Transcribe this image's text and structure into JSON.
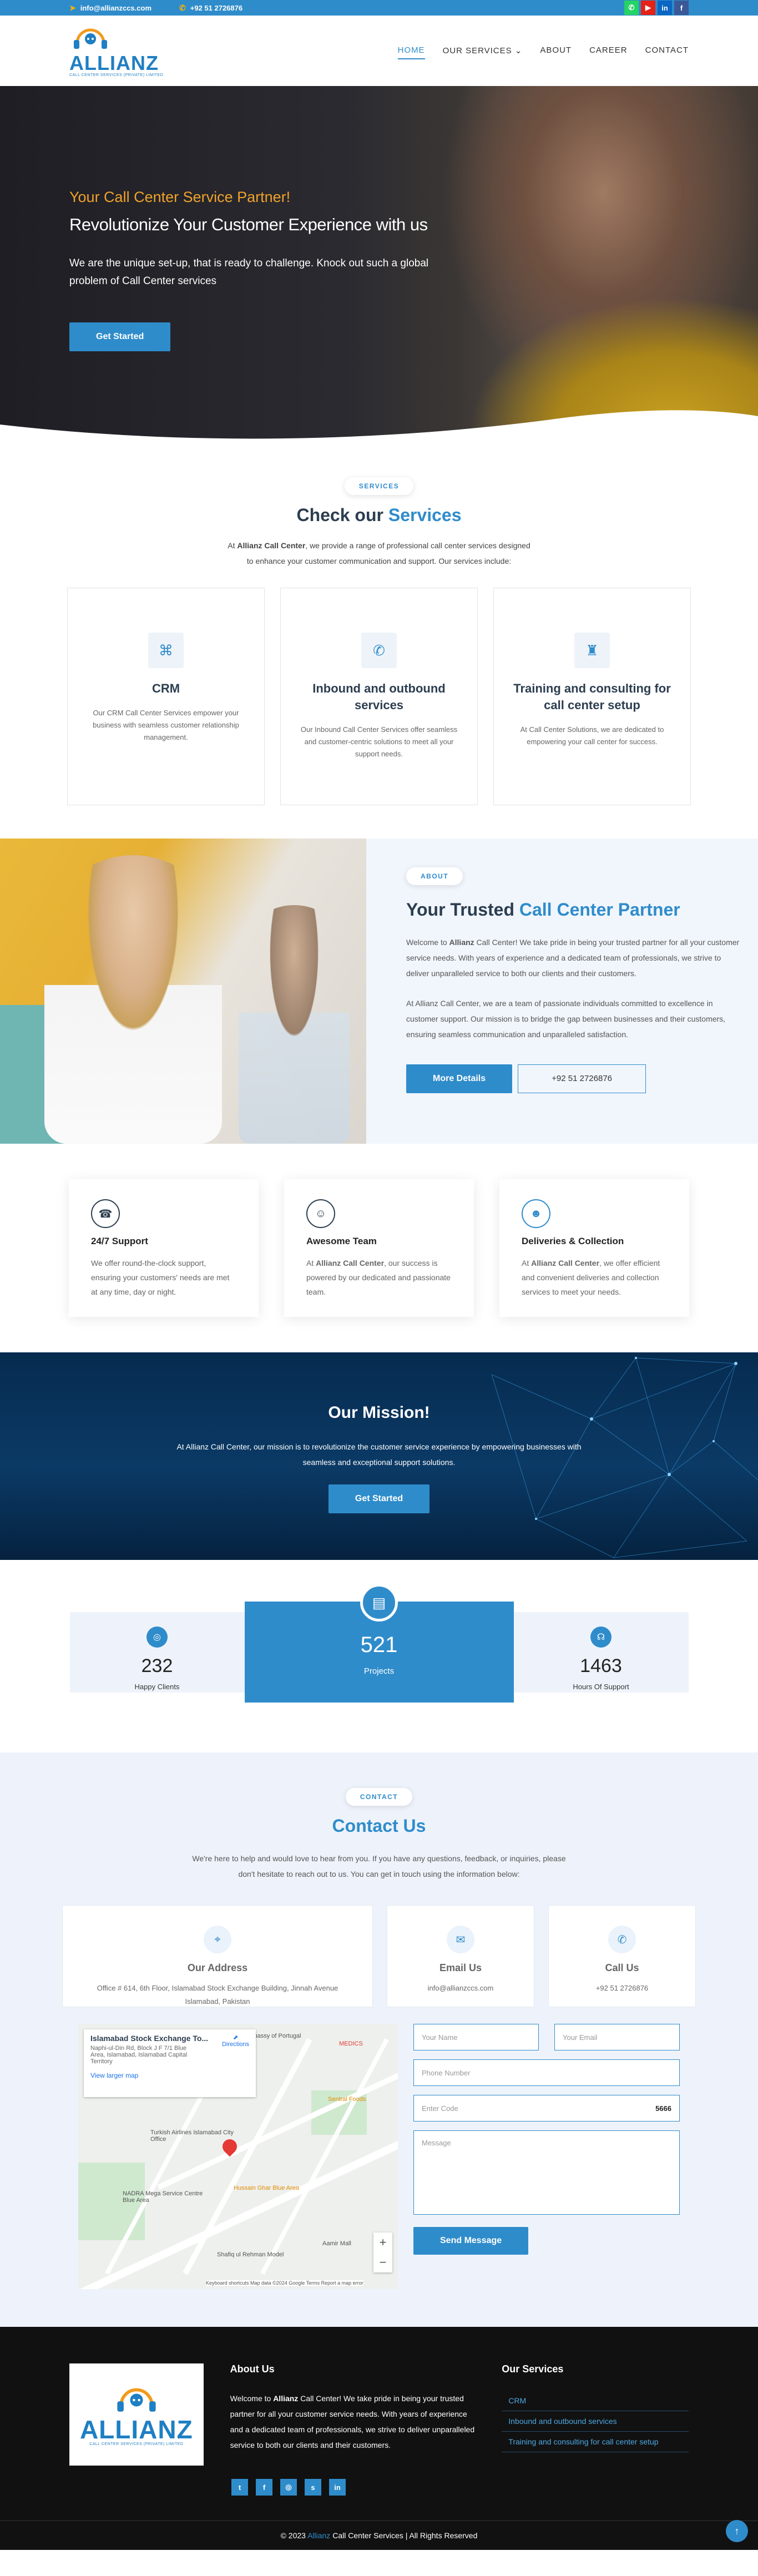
{
  "topbar": {
    "email": "info@allianzccs.com",
    "phone": "+92 51 2726876",
    "socials": [
      {
        "name": "whatsapp-icon",
        "glyph": "✆",
        "color": "#25d366"
      },
      {
        "name": "youtube-icon",
        "glyph": "▶",
        "color": "#e62117"
      },
      {
        "name": "linkedin-icon",
        "glyph": "in",
        "color": "#0a66c2"
      },
      {
        "name": "facebook-icon",
        "glyph": "f",
        "color": "#3b5998"
      }
    ]
  },
  "header": {
    "logo_text": "ALLIANZ",
    "logo_sub": "CALL CENTER SERVICES (PRIVATE) LIMITED",
    "nav": [
      "HOME",
      "OUR SERVICES",
      "ABOUT",
      "CAREER",
      "CONTACT"
    ]
  },
  "hero": {
    "tag": "Your Call Center Service Partner!",
    "title": "Revolutionize Your Customer Experience with us",
    "text": "We are the unique set-up, that is ready to challenge. Knock out such a global problem of Call Center services",
    "cta": "Get Started"
  },
  "services": {
    "pill": "SERVICES",
    "title_a": "Check our ",
    "title_b": "Services",
    "intro_a": "At ",
    "intro_brand": "Allianz Call Center",
    "intro_b": ", we provide a range of professional call center services designed to enhance your customer communication and support. Our services include:",
    "cards": [
      {
        "title": "CRM",
        "text": "Our CRM Call Center Services empower your business with seamless customer relationship management."
      },
      {
        "title": "Inbound and outbound services",
        "text": "Our Inbound Call Center Services offer seamless and customer-centric solutions to meet all your support needs."
      },
      {
        "title": "Training and consulting for call center setup",
        "text": "At Call Center Solutions, we are dedicated to empowering your call center for success."
      }
    ]
  },
  "about": {
    "pill": "ABOUT",
    "title_a": "Your Trusted ",
    "title_b": "Call Center Partner",
    "p1_a": "Welcome to ",
    "p1_brand": "Allianz",
    "p1_b": " Call Center! We take pride in being your trusted partner for all your customer service needs. With years of experience and a dedicated team of professionals, we strive to deliver unparalleled service to both our clients and their customers.",
    "p2": "At Allianz Call Center, we are a team of passionate individuals committed to excellence in customer support. Our mission is to bridge the gap between businesses and their customers, ensuring seamless communication and unparalleled satisfaction.",
    "btn_more": "More Details",
    "btn_phone": "+92 51 2726876"
  },
  "features": [
    {
      "title": "24/7 Support",
      "text_a": "",
      "brand": "",
      "text_b": "We offer round-the-clock support, ensuring your customers' needs are met at any time, day or night."
    },
    {
      "title": "Awesome Team",
      "text_a": "At ",
      "brand": "Allianz Call Center",
      "text_b": ", our success is powered by our dedicated and passionate team."
    },
    {
      "title": "Deliveries & Collection",
      "text_a": "At ",
      "brand": "Allianz Call Center",
      "text_b": ", we offer efficient and convenient deliveries and collection services to meet your needs."
    }
  ],
  "mission": {
    "title": "Our Mission!",
    "text": "At Allianz Call Center, our mission is to revolutionize the customer service experience by empowering businesses with seamless and exceptional support solutions.",
    "cta": "Get Started"
  },
  "stats": [
    {
      "value": "232",
      "label": "Happy Clients"
    },
    {
      "value": "521",
      "label": "Projects"
    },
    {
      "value": "1463",
      "label": "Hours Of Support"
    }
  ],
  "contact": {
    "pill": "CONTACT",
    "title": "Contact Us",
    "intro": "We're here to help and would love to hear from you. If you have any questions, feedback, or inquiries, please don't hesitate to reach out to us. You can get in touch using the information below:",
    "cards": [
      {
        "title": "Our Address",
        "text": "Office # 614, 6th Floor, Islamabad Stock Exchange Building, Jinnah Avenue Islamabad, Pakistan"
      },
      {
        "title": "Email Us",
        "text": "info@allianzccs.com"
      },
      {
        "title": "Call Us",
        "text": "+92 51 2726876"
      }
    ],
    "map": {
      "place": "Islamabad Stock Exchange To...",
      "address": "Naphi-ul-Din Rd, Block J F 7/1 Blue Area, Islamabad, Islamabad Capital Territory",
      "larger_map": "View larger map",
      "directions": "Directions",
      "labels": [
        "Embassy of Portugal",
        "MEDICS",
        "Sentral Foods",
        "Turkish Airlines Islamabad City Office",
        "Hussain Ghar Blue Area",
        "NADRA Mega Service Centre Blue Area",
        "Aamir Mall",
        "Shafiq ul Rehman Model"
      ],
      "footer": "Keyboard shortcuts  Map data ©2024 Google  Terms  Report a map error"
    },
    "form": {
      "name": "Your Name",
      "email": "Your Email",
      "phone": "Phone Number",
      "code": "Enter Code",
      "captcha": "5666",
      "message": "Message",
      "submit": "Send Message"
    }
  },
  "footer": {
    "about_title": "About Us",
    "about_a": "Welcome to ",
    "about_brand": "Allianz",
    "about_b": " Call Center! We take pride in being your trusted partner for all your customer service needs. With years of experience and a dedicated team of professionals, we strive to deliver unparalleled service to both our clients and their customers.",
    "services_title": "Our Services",
    "services": [
      "CRM",
      "Inbound and outbound services",
      "Training and consulting for call center setup"
    ],
    "socials": [
      "twitter-icon",
      "facebook-icon",
      "instagram-icon",
      "skype-icon",
      "linkedin-icon"
    ],
    "social_glyphs": [
      "t",
      "f",
      "◎",
      "s",
      "in"
    ],
    "copy_a": "© 2023 ",
    "copy_brand": "Allianz",
    "copy_b": " Call Center Services | All Rights Reserved"
  }
}
